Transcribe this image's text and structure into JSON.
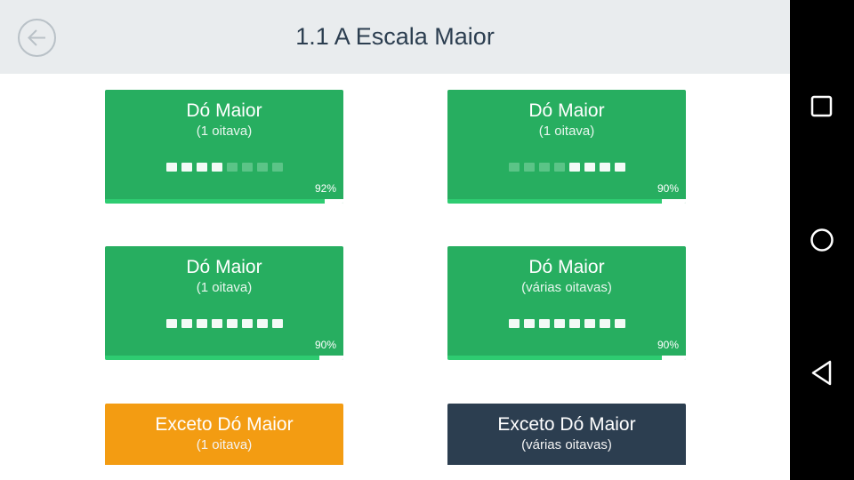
{
  "header": {
    "title": "1.1 A Escala Maior",
    "back_icon": "back-arrow-icon"
  },
  "cards": [
    {
      "title": "Dó Maior",
      "subtitle": "(1 oitava)",
      "color": "#27ae60",
      "dots": [
        true,
        true,
        true,
        true,
        false,
        false,
        false,
        false
      ],
      "percent_label": "92%",
      "progress": 0.92
    },
    {
      "title": "Dó Maior",
      "subtitle": "(1 oitava)",
      "color": "#27ae60",
      "dots": [
        false,
        false,
        false,
        false,
        true,
        true,
        true,
        true
      ],
      "percent_label": "90%",
      "progress": 0.9
    },
    {
      "title": "Dó Maior",
      "subtitle": "(1 oitava)",
      "color": "#27ae60",
      "dots": [
        true,
        true,
        true,
        true,
        true,
        true,
        true,
        true
      ],
      "percent_label": "90%",
      "progress": 0.9
    },
    {
      "title": "Dó Maior",
      "subtitle": "(várias oitavas)",
      "color": "#27ae60",
      "dots": [
        true,
        true,
        true,
        true,
        true,
        true,
        true,
        true
      ],
      "percent_label": "90%",
      "progress": 0.9
    },
    {
      "title": "Exceto Dó Maior",
      "subtitle": "(1 oitava)",
      "color": "#f39c12"
    },
    {
      "title": "Exceto Dó Maior",
      "subtitle": "(várias oitavas)",
      "color": "#2c3e50"
    }
  ],
  "nav_bar": {
    "buttons": [
      "recent-apps-icon",
      "home-icon",
      "back-icon"
    ]
  },
  "colors": {
    "accent_green": "#27ae60",
    "accent_orange": "#f39c12",
    "accent_dark": "#2c3e50",
    "header_bg": "#e9ecee"
  }
}
